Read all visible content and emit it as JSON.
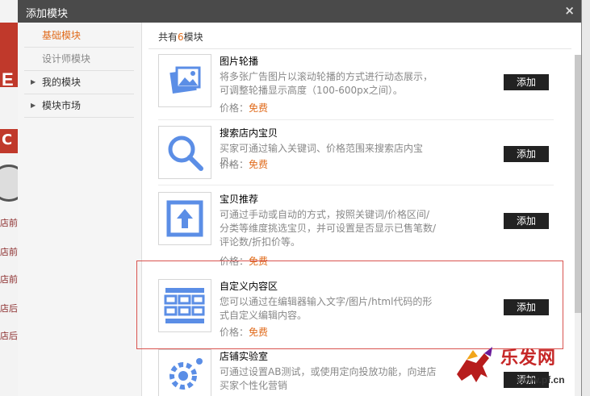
{
  "dialog": {
    "title": "添加模块",
    "close_label": "×"
  },
  "sidebar": {
    "items": [
      {
        "label": "基础模块"
      },
      {
        "label": "设计师模块"
      },
      {
        "label": "我的模块"
      },
      {
        "label": "模块市场"
      }
    ]
  },
  "main": {
    "count_prefix": "共有",
    "count_value": "6",
    "count_suffix": "模块",
    "price_label": "价格：",
    "add_label": "添加",
    "modules": [
      {
        "name": "图片轮播",
        "description": "将多张广告图片以滚动轮播的方式进行动态展示，可调整轮播显示高度（100-600px之间）。",
        "price": "免费",
        "icon": "image-carousel-icon"
      },
      {
        "name": "搜索店内宝贝",
        "description": "买家可通过输入关键词、价格范围来搜索店内宝贝。",
        "price": "免费",
        "icon": "magnifier-icon"
      },
      {
        "name": "宝贝推荐",
        "description": "可通过手动或自动的方式，按照关键词/价格区间/分类等维度挑选宝贝，并可设置是否显示已售笔数/评论数/折扣价等。",
        "price": "免费",
        "icon": "upload-arrow-icon"
      },
      {
        "name": "自定义内容区",
        "description": "您可以通过在编辑器输入文字/图片/html代码的形式自定义编辑内容。",
        "price": "免费",
        "icon": "grid-layout-icon"
      },
      {
        "name": "店铺实验室",
        "description": "可通过设置AB测试，或使用定向投放功能，向进店买家个性化营销",
        "price": "",
        "icon": "gear-lab-icon"
      }
    ]
  },
  "background_page": {
    "fragments": [
      "E",
      "C",
      "店前",
      "店前",
      "店前",
      "店后",
      "店后"
    ]
  },
  "watermark": {
    "text": "乐发网",
    "url": "www.pf.cn"
  },
  "colors": {
    "accent": "#e06b1c",
    "titlebar": "#4a4a4a",
    "icon_blue": "#5b8ee6",
    "button": "#222222",
    "highlight_box": "#d9534f"
  }
}
